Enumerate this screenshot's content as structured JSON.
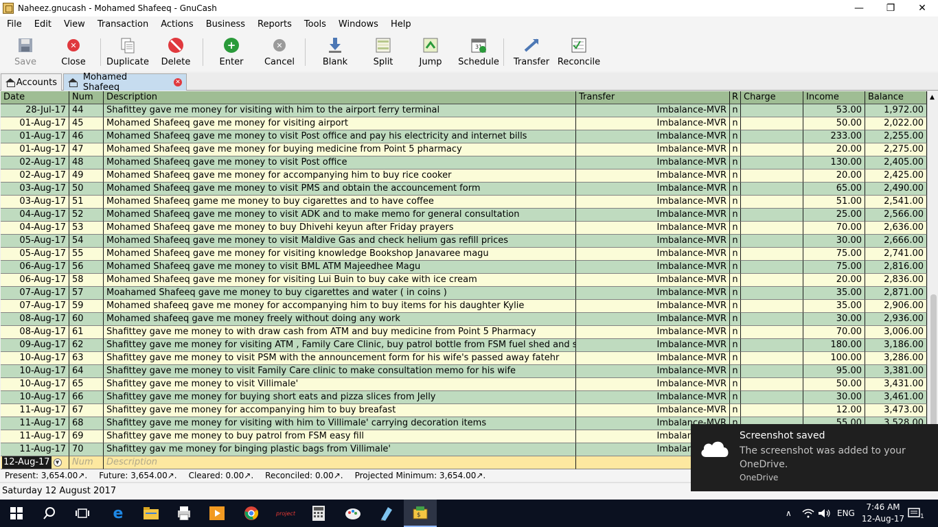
{
  "window": {
    "title": "Naheez.gnucash - Mohamed Shafeeq - GnuCash",
    "minimize": "—",
    "maximize": "❐",
    "close": "✕"
  },
  "menu": [
    "File",
    "Edit",
    "View",
    "Transaction",
    "Actions",
    "Business",
    "Reports",
    "Tools",
    "Windows",
    "Help"
  ],
  "toolbar": {
    "save": "Save",
    "close": "Close",
    "duplicate": "Duplicate",
    "delete": "Delete",
    "enter": "Enter",
    "cancel": "Cancel",
    "blank": "Blank",
    "split": "Split",
    "jump": "Jump",
    "schedule": "Schedule",
    "transfer": "Transfer",
    "reconcile": "Reconcile"
  },
  "tabs": {
    "accounts": "Accounts",
    "register": "Mohamed Shafeeq"
  },
  "columns": {
    "date": "Date",
    "num": "Num",
    "description": "Description",
    "transfer": "Transfer",
    "r": "R",
    "charge": "Charge",
    "income": "Income",
    "balance": "Balance"
  },
  "rows": [
    {
      "date": "28-Jul-17",
      "num": "44",
      "desc": "Shafittey gave me money for visiting with him to the airport ferry terminal",
      "transfer": "Imbalance-MVR",
      "r": "n",
      "income": "53.00",
      "balance": "1,972.00"
    },
    {
      "date": "01-Aug-17",
      "num": "45",
      "desc": "Mohamed Shafeeq gave me money for visiting airport",
      "transfer": "Imbalance-MVR",
      "r": "n",
      "income": "50.00",
      "balance": "2,022.00"
    },
    {
      "date": "01-Aug-17",
      "num": "46",
      "desc": "Mohamed Shafeeq gave me money to visit Post office and pay his electricity and internet bills",
      "transfer": "Imbalance-MVR",
      "r": "n",
      "income": "233.00",
      "balance": "2,255.00"
    },
    {
      "date": "01-Aug-17",
      "num": "47",
      "desc": "Mohamed Shafeeq gave me money for buying medicine from Point 5 pharmacy",
      "transfer": "Imbalance-MVR",
      "r": "n",
      "income": "20.00",
      "balance": "2,275.00"
    },
    {
      "date": "02-Aug-17",
      "num": "48",
      "desc": "Mohamed Shafeeq gave me money to visit Post office",
      "transfer": "Imbalance-MVR",
      "r": "n",
      "income": "130.00",
      "balance": "2,405.00"
    },
    {
      "date": "02-Aug-17",
      "num": "49",
      "desc": "Mohamed Shafeeq gave me money for accompanying him to buy rice cooker",
      "transfer": "Imbalance-MVR",
      "r": "n",
      "income": "20.00",
      "balance": "2,425.00"
    },
    {
      "date": "03-Aug-17",
      "num": "50",
      "desc": "Mohamed Shafeeq gave me money to visit PMS and obtain the accouncement form",
      "transfer": "Imbalance-MVR",
      "r": "n",
      "income": "65.00",
      "balance": "2,490.00"
    },
    {
      "date": "03-Aug-17",
      "num": "51",
      "desc": "Mohamed Shafeeq game me money to buy cigarettes and to have coffee",
      "transfer": "Imbalance-MVR",
      "r": "n",
      "income": "51.00",
      "balance": "2,541.00"
    },
    {
      "date": "04-Aug-17",
      "num": "52",
      "desc": "Mohamed Shafeeq gave me money to visit ADK and to make memo for general consultation",
      "transfer": "Imbalance-MVR",
      "r": "n",
      "income": "25.00",
      "balance": "2,566.00"
    },
    {
      "date": "04-Aug-17",
      "num": "53",
      "desc": "Mohamed Shafeeq gave me money to buy Dhivehi keyun after Friday prayers",
      "transfer": "Imbalance-MVR",
      "r": "n",
      "income": "70.00",
      "balance": "2,636.00"
    },
    {
      "date": "05-Aug-17",
      "num": "54",
      "desc": "Mohamed Shafeeq gave me money to visit Maldive Gas and check helium gas refill prices",
      "transfer": "Imbalance-MVR",
      "r": "n",
      "income": "30.00",
      "balance": "2,666.00"
    },
    {
      "date": "05-Aug-17",
      "num": "55",
      "desc": "Mohamed Shafeeq gave me money for visiting knowledge Bookshop Janavaree magu",
      "transfer": "Imbalance-MVR",
      "r": "n",
      "income": "75.00",
      "balance": "2,741.00"
    },
    {
      "date": "06-Aug-17",
      "num": "56",
      "desc": "Mohamed Shafeeq gave me money to visit BML ATM Majeedhee Magu",
      "transfer": "Imbalance-MVR",
      "r": "n",
      "income": "75.00",
      "balance": "2,816.00"
    },
    {
      "date": "06-Aug-17",
      "num": "58",
      "desc": "Mohamed Shafeeq gave me money for visiting Lui Buin to buy cake with ice cream",
      "transfer": "Imbalance-MVR",
      "r": "n",
      "income": "20.00",
      "balance": "2,836.00"
    },
    {
      "date": "07-Aug-17",
      "num": "57",
      "desc": "Moahamed Shafeeq gave me money to buy cigarettes and water ( in coins )",
      "transfer": "Imbalance-MVR",
      "r": "n",
      "income": "35.00",
      "balance": "2,871.00"
    },
    {
      "date": "07-Aug-17",
      "num": "59",
      "desc": "Mohamed shafeeq gave me money for accompanying him to buy items for his daughter Kylie",
      "transfer": "Imbalance-MVR",
      "r": "n",
      "income": "35.00",
      "balance": "2,906.00"
    },
    {
      "date": "08-Aug-17",
      "num": "60",
      "desc": "Mohamed shafeeq gave me money freely without doing any work",
      "transfer": "Imbalance-MVR",
      "r": "n",
      "income": "30.00",
      "balance": "2,936.00"
    },
    {
      "date": "08-Aug-17",
      "num": "61",
      "desc": "Shafittey gave me money to with draw cash from ATM and buy medicine from Point 5 Pharmacy",
      "transfer": "Imbalance-MVR",
      "r": "n",
      "income": "70.00",
      "balance": "3,006.00"
    },
    {
      "date": "09-Aug-17",
      "num": "62",
      "desc": "Shafittey gave me money for visiting ATM , Family Care Clinic, buy patrol bottle from FSM fuel shed and she",
      "transfer": "Imbalance-MVR",
      "r": "n",
      "income": "180.00",
      "balance": "3,186.00"
    },
    {
      "date": "10-Aug-17",
      "num": "63",
      "desc": "Shafittey gave me money to visit PSM with the announcement form for his wife's passed away fatehr",
      "transfer": "Imbalance-MVR",
      "r": "n",
      "income": "100.00",
      "balance": "3,286.00"
    },
    {
      "date": "10-Aug-17",
      "num": "64",
      "desc": "Shafittey gave me money to visit Family Care clinic to make consultation memo for his wife",
      "transfer": "Imbalance-MVR",
      "r": "n",
      "income": "95.00",
      "balance": "3,381.00"
    },
    {
      "date": "10-Aug-17",
      "num": "65",
      "desc": "Shafittey gave me money to visit Villimale'",
      "transfer": "Imbalance-MVR",
      "r": "n",
      "income": "50.00",
      "balance": "3,431.00"
    },
    {
      "date": "10-Aug-17",
      "num": "66",
      "desc": "Shafittey gave me money for  buying short eats and pizza slices from Jelly",
      "transfer": "Imbalance-MVR",
      "r": "n",
      "income": "30.00",
      "balance": "3,461.00"
    },
    {
      "date": "11-Aug-17",
      "num": "67",
      "desc": "Shafittey gave me money for accompanying him to buy breafast",
      "transfer": "Imbalance-MVR",
      "r": "n",
      "income": "12.00",
      "balance": "3,473.00"
    },
    {
      "date": "11-Aug-17",
      "num": "68",
      "desc": "Shafittey gave me money for visiting with him to Villimale' carrying decoration items",
      "transfer": "Imbalance-MVR",
      "r": "n",
      "income": "55.00",
      "balance": "3,528.00"
    },
    {
      "date": "11-Aug-17",
      "num": "69",
      "desc": "Shafittey gave me money to buy patrol from FSM easy fill",
      "transfer": "Imbalance-MVR",
      "r": "n",
      "income": "",
      "balance": ""
    },
    {
      "date": "11-Aug-17",
      "num": "70",
      "desc": "Shafittey gav me money for binging plastic bags from Villimale'",
      "transfer": "Imbalance-MVR",
      "r": "n",
      "income": "",
      "balance": ""
    }
  ],
  "blank_row": {
    "date": "12-Aug-17",
    "num_placeholder": "Num",
    "desc_placeholder": "Description"
  },
  "summary": {
    "present": "Present: 3,654.00↗.",
    "future": "Future: 3,654.00↗.",
    "cleared": "Cleared: 0.00↗.",
    "reconciled": "Reconciled: 0.00↗.",
    "projected": "Projected Minimum: 3,654.00↗."
  },
  "status": "Saturday 12 August 2017",
  "notification": {
    "title": "Screenshot saved",
    "body": "The screenshot was added to your OneDrive.",
    "source": "OneDrive"
  },
  "taskbar": {
    "lang": "ENG",
    "time": "7:46 AM",
    "date": "12-Aug-17",
    "notify_count": "1"
  },
  "colors": {
    "header_green": "#9fbd94",
    "row_yellow": "#fbfcd8",
    "row_green": "#bfdbbf",
    "blank_row": "#fde8a0",
    "active_tab": "#c6dcef"
  }
}
